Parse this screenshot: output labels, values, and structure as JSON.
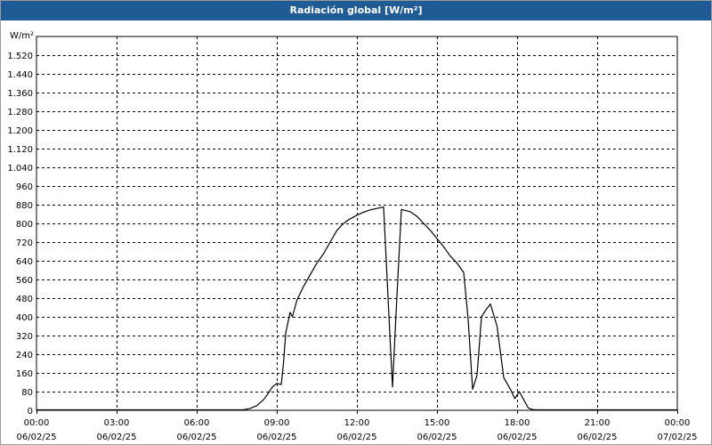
{
  "window": {
    "title": "Radiación global [W/m²]"
  },
  "chart_data": {
    "type": "line",
    "title": "Radiación global [W/m²]",
    "ylabel": "W/m²",
    "ylim": [
      0,
      1600
    ],
    "y_ticks": [
      0,
      80,
      160,
      240,
      320,
      400,
      480,
      560,
      640,
      720,
      800,
      880,
      960,
      1040,
      1120,
      1200,
      1280,
      1360,
      1440,
      1520
    ],
    "y_tick_labels": [
      "0",
      "80",
      "160",
      "240",
      "320",
      "400",
      "480",
      "560",
      "640",
      "720",
      "800",
      "880",
      "960",
      "1.040",
      "1.120",
      "1.200",
      "1.280",
      "1.360",
      "1.440",
      "1.520"
    ],
    "x_range": [
      "06/02/25 00:00",
      "07/02/25 00:00"
    ],
    "x_ticks": [
      {
        "time": "00:00",
        "date": "06/02/25"
      },
      {
        "time": "03:00",
        "date": "06/02/25"
      },
      {
        "time": "06:00",
        "date": "06/02/25"
      },
      {
        "time": "09:00",
        "date": "06/02/25"
      },
      {
        "time": "12:00",
        "date": "06/02/25"
      },
      {
        "time": "15:00",
        "date": "06/02/25"
      },
      {
        "time": "18:00",
        "date": "06/02/25"
      },
      {
        "time": "21:00",
        "date": "06/02/25"
      },
      {
        "time": "00:00",
        "date": "07/02/25"
      }
    ],
    "grid": true,
    "series": [
      {
        "color": "#000000",
        "points": [
          [
            "00:00",
            2
          ],
          [
            "07:45",
            2
          ],
          [
            "08:00",
            8
          ],
          [
            "08:15",
            20
          ],
          [
            "08:30",
            45
          ],
          [
            "08:40",
            70
          ],
          [
            "08:50",
            100
          ],
          [
            "09:00",
            115
          ],
          [
            "09:10",
            110
          ],
          [
            "09:15",
            200
          ],
          [
            "09:20",
            330
          ],
          [
            "09:30",
            420
          ],
          [
            "09:35",
            400
          ],
          [
            "09:45",
            470
          ],
          [
            "10:00",
            530
          ],
          [
            "10:15",
            580
          ],
          [
            "10:30",
            630
          ],
          [
            "10:45",
            670
          ],
          [
            "11:00",
            720
          ],
          [
            "11:15",
            770
          ],
          [
            "11:30",
            800
          ],
          [
            "11:45",
            820
          ],
          [
            "12:00",
            835
          ],
          [
            "12:15",
            848
          ],
          [
            "12:30",
            858
          ],
          [
            "12:45",
            864
          ],
          [
            "13:00",
            870
          ],
          [
            "13:15",
            290
          ],
          [
            "13:20",
            100
          ],
          [
            "13:30",
            490
          ],
          [
            "13:40",
            860
          ],
          [
            "14:00",
            850
          ],
          [
            "14:15",
            830
          ],
          [
            "14:30",
            800
          ],
          [
            "14:45",
            770
          ],
          [
            "15:00",
            735
          ],
          [
            "15:15",
            700
          ],
          [
            "15:30",
            660
          ],
          [
            "15:45",
            630
          ],
          [
            "16:00",
            590
          ],
          [
            "16:10",
            390
          ],
          [
            "16:20",
            90
          ],
          [
            "16:30",
            150
          ],
          [
            "16:40",
            400
          ],
          [
            "16:50",
            430
          ],
          [
            "17:00",
            455
          ],
          [
            "17:15",
            360
          ],
          [
            "17:30",
            140
          ],
          [
            "17:45",
            90
          ],
          [
            "17:55",
            50
          ],
          [
            "18:05",
            80
          ],
          [
            "18:15",
            45
          ],
          [
            "18:25",
            10
          ],
          [
            "18:35",
            3
          ],
          [
            "18:45",
            2
          ],
          [
            "24:00",
            2
          ]
        ]
      }
    ]
  }
}
